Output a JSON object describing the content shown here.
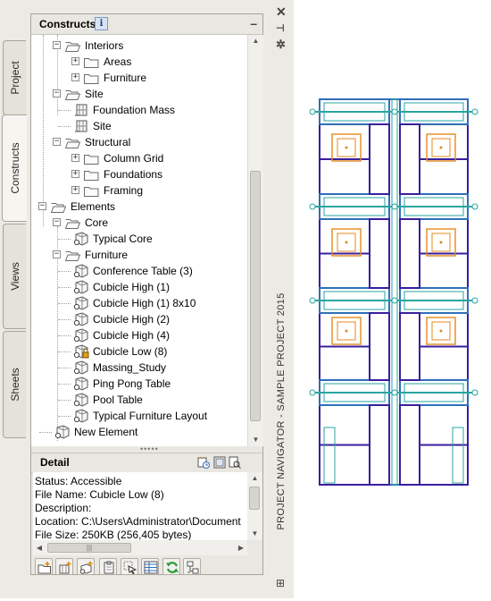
{
  "palette": {
    "title": "PROJECT NAVIGATOR - SAMPLE PROJECT 2015",
    "tabs": [
      "Project",
      "Constructs",
      "Views",
      "Sheets"
    ],
    "active_tab": "Constructs"
  },
  "constructs": {
    "title": "Constructs",
    "info_glyph": "i",
    "minimize_glyph": "–"
  },
  "tree": [
    {
      "label": "Interiors",
      "kind": "folder-open",
      "level": 2
    },
    {
      "label": "Areas",
      "kind": "folder",
      "level": 3
    },
    {
      "label": "Furniture",
      "kind": "folder",
      "level": 3
    },
    {
      "label": "Site",
      "kind": "folder-open",
      "level": 2
    },
    {
      "label": "Foundation Mass",
      "kind": "construct",
      "level": 3
    },
    {
      "label": "Site",
      "kind": "construct",
      "level": 3
    },
    {
      "label": "Structural",
      "kind": "folder-open",
      "level": 2
    },
    {
      "label": "Column Grid",
      "kind": "folder",
      "level": 3
    },
    {
      "label": "Foundations",
      "kind": "folder",
      "level": 3
    },
    {
      "label": "Framing",
      "kind": "folder",
      "level": 3
    },
    {
      "label": "Elements",
      "kind": "folder-open",
      "level": 1
    },
    {
      "label": "Core",
      "kind": "folder-open",
      "level": 2
    },
    {
      "label": "Typical Core",
      "kind": "element",
      "level": 3
    },
    {
      "label": "Furniture",
      "kind": "folder-open",
      "level": 2
    },
    {
      "label": "Conference Table (3)",
      "kind": "element",
      "level": 3
    },
    {
      "label": "Cubicle High (1)",
      "kind": "element",
      "level": 3
    },
    {
      "label": "Cubicle High (1) 8x10",
      "kind": "element",
      "level": 3
    },
    {
      "label": "Cubicle High (2)",
      "kind": "element",
      "level": 3
    },
    {
      "label": "Cubicle High (4)",
      "kind": "element",
      "level": 3
    },
    {
      "label": "Cubicle Low (8)",
      "kind": "element-locked",
      "level": 3
    },
    {
      "label": "Massing_Study",
      "kind": "element",
      "level": 3
    },
    {
      "label": "Ping Pong Table",
      "kind": "element",
      "level": 3
    },
    {
      "label": "Pool Table",
      "kind": "element",
      "level": 3
    },
    {
      "label": "Typical Furniture Layout",
      "kind": "element",
      "level": 3
    },
    {
      "label": "New Element",
      "kind": "element",
      "level": 2
    }
  ],
  "detail": {
    "title": "Detail",
    "lines": [
      "Status: Accessible",
      "File Name: Cubicle Low (8)",
      "Description:",
      "Location: C:\\Users\\Administrator\\Document",
      "File Size: 250KB (256,405 bytes)"
    ],
    "icons": [
      "history-icon",
      "preview-icon",
      "zoom-preview-icon"
    ]
  },
  "toolbar": {
    "buttons": [
      "new-category-icon",
      "new-construct-icon",
      "new-element-icon",
      "clipboard-icon",
      "select-object-icon",
      "properties-grid-icon",
      "refresh-icon",
      "repath-icon"
    ],
    "colors": {
      "refresh": "#2e9a3a",
      "new": "#e08a18",
      "element": "#555555"
    }
  },
  "window_controls": [
    "close-icon",
    "pin-icon",
    "settings-icon"
  ],
  "colors": {
    "drawing_purple": "#3a1e9c",
    "drawing_teal": "#2aa5a0",
    "drawing_orange": "#e58a1c",
    "drawing_blue": "#2f6fb8"
  }
}
